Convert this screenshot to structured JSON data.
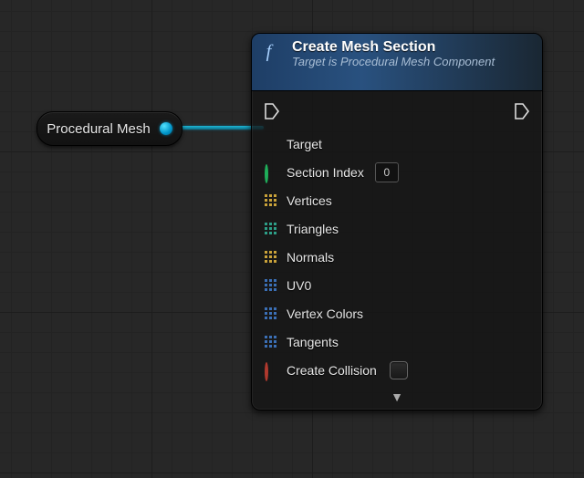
{
  "var_node": {
    "label": "Procedural Mesh"
  },
  "func_node": {
    "title": "Create Mesh Section",
    "subtitle": "Target is Procedural Mesh Component",
    "inputs": {
      "target": "Target",
      "section_index": {
        "label": "Section Index",
        "value": "0"
      },
      "vertices": "Vertices",
      "triangles": "Triangles",
      "normals": "Normals",
      "uv0": "UV0",
      "vertex_colors": "Vertex Colors",
      "tangents": "Tangents",
      "create_collision": "Create Collision"
    }
  }
}
